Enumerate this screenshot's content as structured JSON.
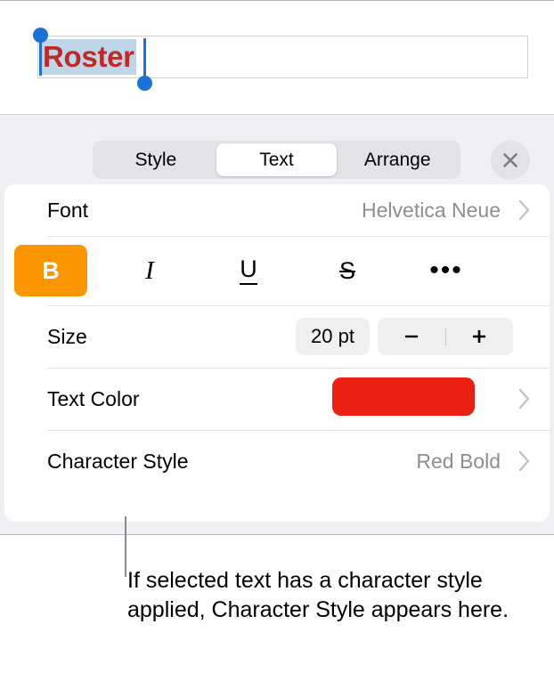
{
  "canvas": {
    "title_text": "Roster",
    "title_text_color": "#bf2a26",
    "selection_highlight_color": "#bfd6ea",
    "selection_handle_color": "#1a73d4"
  },
  "panel": {
    "tabs": [
      {
        "label": "Style",
        "selected": false
      },
      {
        "label": "Text",
        "selected": true
      },
      {
        "label": "Arrange",
        "selected": false
      }
    ],
    "close_label": "close-icon",
    "rows": {
      "font": {
        "label": "Font",
        "value": "Helvetica Neue"
      },
      "style_buttons": [
        {
          "name": "bold",
          "glyph": "B",
          "active": true
        },
        {
          "name": "italic",
          "glyph": "I",
          "active": false
        },
        {
          "name": "underline",
          "glyph": "U",
          "active": false
        },
        {
          "name": "strikethrough",
          "glyph": "S",
          "active": false
        },
        {
          "name": "more",
          "glyph": "•••",
          "active": false
        }
      ],
      "size": {
        "label": "Size",
        "value": "20 pt",
        "decrement": "−",
        "increment": "+"
      },
      "text_color": {
        "label": "Text Color",
        "swatch_color": "#ec2011"
      },
      "character_style": {
        "label": "Character Style",
        "value": "Red Bold"
      }
    },
    "accent_active_color": "#fb9500",
    "panel_background": "#f0eff4"
  },
  "callout": {
    "text": "If selected text has a character style applied, Character Style appears here."
  }
}
